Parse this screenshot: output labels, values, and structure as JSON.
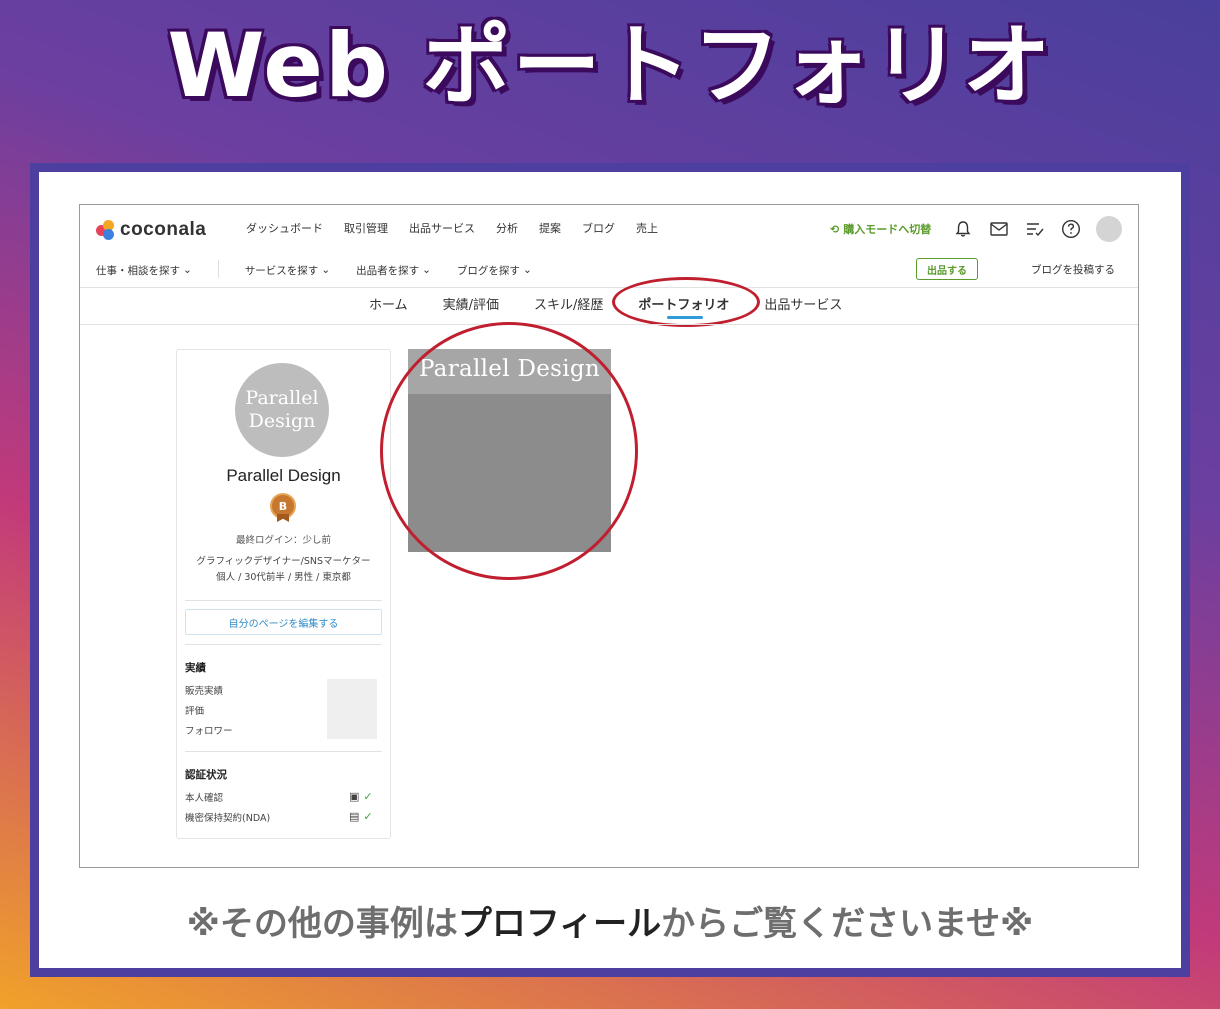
{
  "banner": {
    "title": "Web ポートフォリオ"
  },
  "header": {
    "logo_text": "coconala",
    "nav": [
      "ダッシュボード",
      "取引管理",
      "出品サービス",
      "分析",
      "提案",
      "ブログ",
      "売上"
    ],
    "mode_switch": "購入モードへ切替",
    "subnav": [
      "仕事・相談を探す",
      "サービスを探す",
      "出品者を探す",
      "ブログを探す"
    ],
    "listing_button": "出品する",
    "blog_post": "ブログを投稿する"
  },
  "tabs": [
    {
      "label": "ホーム",
      "active": false
    },
    {
      "label": "実績/評価",
      "active": false
    },
    {
      "label": "スキル/経歴",
      "active": false
    },
    {
      "label": "ポートフォリオ",
      "active": true
    },
    {
      "label": "出品サービス",
      "active": false
    }
  ],
  "profile": {
    "avatar_line1": "Parallel",
    "avatar_line2": "Design",
    "name": "Parallel Design",
    "badge": "B",
    "last_login": "最終ログイン：少し前",
    "job": "グラフィックデザイナー/SNSマーケター",
    "meta": "個人 / 30代前半 / 男性 / 東京都",
    "edit_button": "自分のページを編集する",
    "results_title": "実績",
    "results": [
      "販売実績",
      "評価",
      "フォロワー"
    ],
    "verify_title": "認証状況",
    "verify": [
      "本人確認",
      "機密保持契約(NDA)"
    ]
  },
  "portfolio": {
    "thumb_title": "Parallel Design"
  },
  "note": {
    "before": "※その他の事例は",
    "emphasis": "プロフィール",
    "after": "からご覧くださいませ※"
  },
  "colors": {
    "accent_green": "#5a9b2c",
    "tab_underline": "#2f9bd8",
    "highlight_ring": "#c01f2f"
  }
}
